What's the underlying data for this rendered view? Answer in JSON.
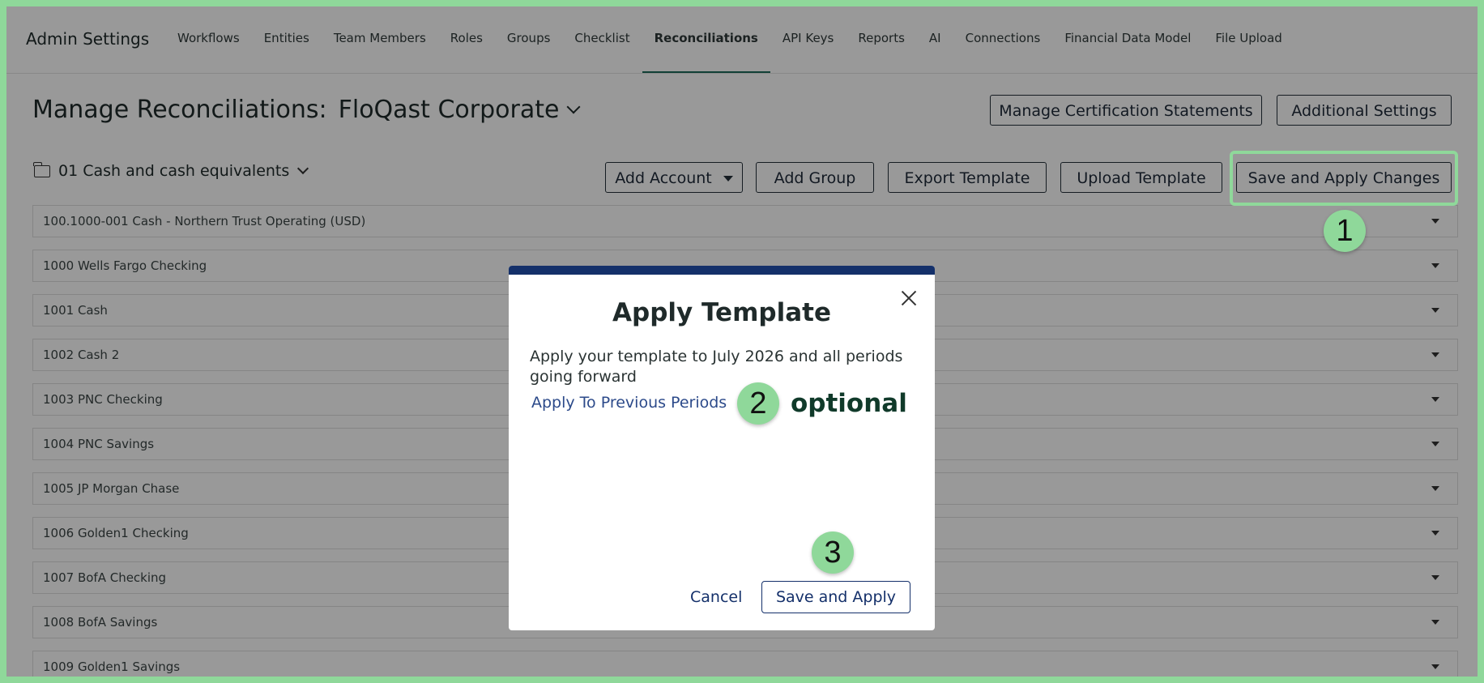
{
  "nav": {
    "title": "Admin Settings",
    "items": [
      {
        "label": "Workflows"
      },
      {
        "label": "Entities"
      },
      {
        "label": "Team Members"
      },
      {
        "label": "Roles"
      },
      {
        "label": "Groups"
      },
      {
        "label": "Checklist"
      },
      {
        "label": "Reconciliations",
        "active": true
      },
      {
        "label": "API Keys"
      },
      {
        "label": "Reports"
      },
      {
        "label": "AI"
      },
      {
        "label": "Connections"
      },
      {
        "label": "Financial Data Model"
      },
      {
        "label": "File Upload"
      }
    ]
  },
  "header": {
    "title": "Manage Reconciliations:",
    "entity": "FloQast Corporate",
    "manage_cert_label": "Manage Certification Statements",
    "additional_settings_label": "Additional Settings"
  },
  "toolbar": {
    "folder": "01 Cash and cash equivalents",
    "add_account": "Add Account",
    "add_group": "Add Group",
    "export_template": "Export Template",
    "upload_template": "Upload Template",
    "save_apply_changes": "Save and Apply Changes"
  },
  "accounts": [
    "100.1000-001 Cash - Northern Trust Operating (USD)",
    "1000 Wells Fargo Checking",
    "1001 Cash",
    "1002 Cash 2",
    "1003 PNC Checking",
    "1004 PNC Savings",
    "1005 JP Morgan Chase",
    "1006 Golden1 Checking",
    "1007 BofA Checking",
    "1008 BofA Savings",
    "1009 Golden1 Savings"
  ],
  "modal": {
    "title": "Apply Template",
    "description": "Apply your template to July 2026 and all periods going forward",
    "previous_link": "Apply To Previous Periods",
    "optional_note": "optional",
    "cancel": "Cancel",
    "save_apply": "Save and Apply"
  },
  "steps": {
    "one": "1",
    "two": "2",
    "three": "3"
  },
  "colors": {
    "highlight": "#8fd89a",
    "modal_bar": "#14306a",
    "active_underline": "#1d6b5a"
  }
}
